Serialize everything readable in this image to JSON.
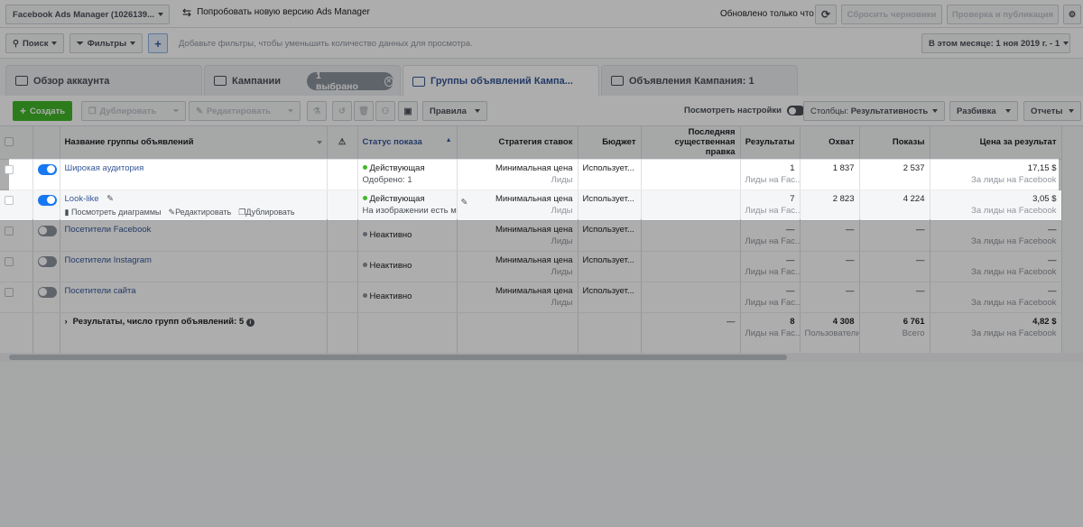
{
  "topbar": {
    "account_selector": "Facebook Ads Manager (1026139...",
    "try_new_version": "Попробовать новую версию Ads Manager",
    "updated_status": "Обновлено только что",
    "discard_drafts": "Сбросить черновики",
    "review_publish": "Проверка и публикация"
  },
  "filterbar": {
    "search": "Поиск",
    "filters": "Фильтры",
    "filter_placeholder": "Добавьте фильтры, чтобы уменьшить количество данных для просмотра.",
    "date_range": "В этом месяце: 1 ноя 2019 г. - 1"
  },
  "tabs": {
    "account_overview": "Обзор аккаунта",
    "campaigns": "Кампании",
    "selected_pill": "1 выбрано",
    "ad_sets": "Группы объявлений Кампа...",
    "ads": "Объявления Кампания: 1"
  },
  "toolbar": {
    "create": "Создать",
    "duplicate": "Дублировать",
    "edit": "Редактировать",
    "rules": "Правила",
    "view_settings": "Посмотреть настройки",
    "columns_prefix": "Столбцы:",
    "columns_value": "Результативность",
    "breakdown": "Разбивка",
    "reports": "Отчеты"
  },
  "table": {
    "headers": {
      "name": "Название группы объявлений",
      "delivery": "Статус показа",
      "bid_strategy": "Стратегия ставок",
      "budget": "Бюджет",
      "last_edit": "Последняя существенная правка",
      "results": "Результаты",
      "reach": "Охват",
      "impressions": "Показы",
      "cost_per_result": "Цена за результат"
    },
    "rows": [
      {
        "name": "Широкая аудитория",
        "delivery": "Действующая",
        "delivery_sub": "Одобрено: 1",
        "bid": "Минимальная цена",
        "bid_sub": "Лиды",
        "budget": "Использует...",
        "results": "1",
        "results_sub": "Лиды на Fac...",
        "reach": "1 837",
        "impressions": "2 537",
        "cost": "17,15 $",
        "cost_sub": "За лиды на Facebook"
      },
      {
        "name": "Look-like",
        "delivery": "Действующая",
        "delivery_sub": "На изображении есть м",
        "bid": "Минимальная цена",
        "bid_sub": "Лиды",
        "budget": "Использует...",
        "results": "7",
        "results_sub": "Лиды на Fac...",
        "reach": "2 823",
        "impressions": "4 224",
        "cost": "3,05 $",
        "cost_sub": "За лиды на Facebook",
        "action_charts": "Посмотреть диаграммы",
        "action_edit": "Редактировать",
        "action_duplicate": "Дублировать"
      },
      {
        "name": "Посетители Facebook",
        "delivery": "Неактивно",
        "bid": "Минимальная цена",
        "bid_sub": "Лиды",
        "budget": "Использует...",
        "results": "—",
        "results_sub": "Лиды на Fac...",
        "reach": "—",
        "impressions": "—",
        "cost": "—",
        "cost_sub": "За лиды на Facebook"
      },
      {
        "name": "Посетители Instagram",
        "delivery": "Неактивно",
        "bid": "Минимальная цена",
        "bid_sub": "Лиды",
        "budget": "Использует...",
        "results": "—",
        "results_sub": "Лиды на Fac...",
        "reach": "—",
        "impressions": "—",
        "cost": "—",
        "cost_sub": "За лиды на Facebook"
      },
      {
        "name": "Посетители сайта",
        "delivery": "Неактивно",
        "bid": "Минимальная цена",
        "bid_sub": "Лиды",
        "budget": "Использует...",
        "results": "—",
        "results_sub": "Лиды на Fac...",
        "reach": "—",
        "impressions": "—",
        "cost": "—",
        "cost_sub": "За лиды на Facebook"
      }
    ],
    "summary": {
      "label": "Результаты, число групп объявлений: 5",
      "last_edit": "—",
      "results": "8",
      "results_sub": "Лиды на Fac...",
      "reach": "4 308",
      "reach_sub": "Пользователи",
      "impressions": "6 761",
      "impressions_sub": "Всего",
      "cost": "4,82 $",
      "cost_sub": "За лиды на Facebook"
    }
  },
  "colors": {
    "accent": "#365899",
    "green": "#42b72a",
    "active_dot": "#42b72a",
    "inactive_dot": "#8d949e",
    "toggle_on": "#1877f2"
  }
}
